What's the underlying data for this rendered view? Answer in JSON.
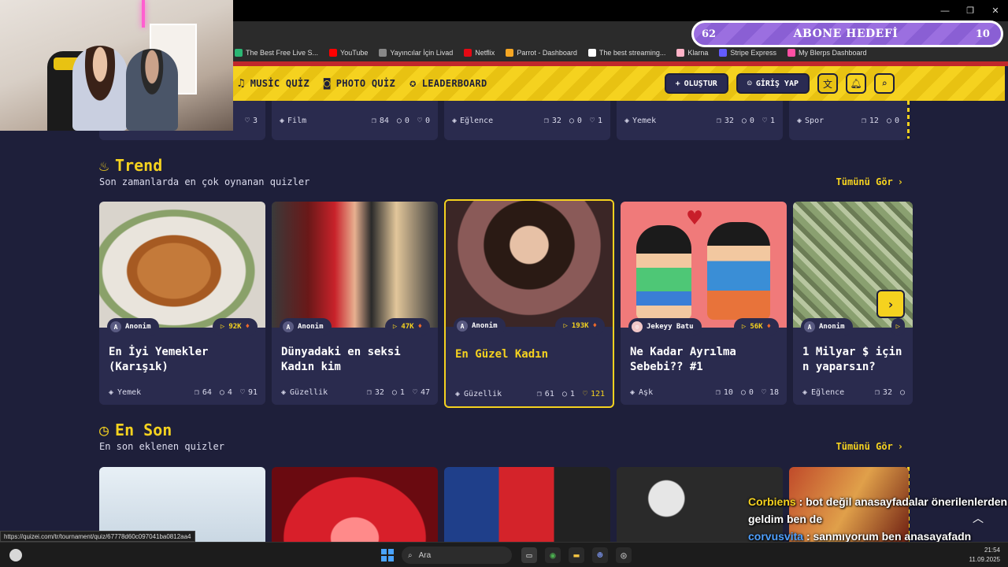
{
  "browser": {
    "bookmarks": [
      {
        "label": "The Best Free Live S...",
        "color": "#2bb673"
      },
      {
        "label": "YouTube",
        "color": "#ff0000"
      },
      {
        "label": "Yayıncılar İçin Livad",
        "color": "#888888"
      },
      {
        "label": "Netflix",
        "color": "#e50914"
      },
      {
        "label": "Parrot - Dashboard",
        "color": "#f5a623"
      },
      {
        "label": "The best streaming...",
        "color": "#ffffff"
      },
      {
        "label": "Klarna",
        "color": "#ffb3c7"
      },
      {
        "label": "Stripe Express",
        "color": "#635bff"
      },
      {
        "label": "My Blerps Dashboard",
        "color": "#ff4fa3"
      }
    ],
    "status_url": "https://quizei.com/tr/tournament/quiz/67778d60c097041ba0812aa4"
  },
  "sub_goal": {
    "current": "62",
    "title": "ABONE HEDEFİ",
    "target": "10"
  },
  "header": {
    "nav": [
      {
        "label": "MUSİC QUİZ",
        "icon": "music-icon"
      },
      {
        "label": "PHOTO QUİZ",
        "icon": "camera-icon"
      },
      {
        "label": "LEADERBOARD",
        "icon": "medal-icon"
      }
    ],
    "create_label": "OLUŞTUR",
    "login_label": "GİRİŞ YAP"
  },
  "top_row": [
    {
      "category": "",
      "likes": "3"
    },
    {
      "category": "Film",
      "questions": "84",
      "comments": "0",
      "likes": "0"
    },
    {
      "category": "Eğlence",
      "questions": "32",
      "comments": "0",
      "likes": "1"
    },
    {
      "category": "Yemek",
      "questions": "32",
      "comments": "0",
      "likes": "1"
    },
    {
      "category": "Spor",
      "questions": "12",
      "comments": "0"
    }
  ],
  "trend": {
    "title": "Trend",
    "subtitle": "Son zamanlarda en çok oynanan quizler",
    "see_all": "Tümünü Gör",
    "cards": [
      {
        "author": "Anonim",
        "plays": "92K",
        "title": "En İyi Yemekler (Karışık)",
        "category": "Yemek",
        "questions": "64",
        "comments": "4",
        "likes": "91"
      },
      {
        "author": "Anonim",
        "plays": "47K",
        "title": "Dünyadaki en seksi Kadın kim",
        "category": "Güzellik",
        "questions": "32",
        "comments": "1",
        "likes": "47"
      },
      {
        "author": "Anonim",
        "plays": "193K",
        "title": "En Güzel Kadın",
        "category": "Güzellik",
        "questions": "61",
        "comments": "1",
        "likes": "121"
      },
      {
        "author": "Jekeyy Batu",
        "plays": "56K",
        "title": "Ne Kadar Ayrılma Sebebi?? #1",
        "category": "Aşk",
        "questions": "10",
        "comments": "0",
        "likes": "18"
      },
      {
        "author": "Anonim",
        "plays": "",
        "title": "1 Milyar $ için n yaparsın?",
        "category": "Eğlence",
        "questions": "32",
        "comments": "",
        "likes": ""
      }
    ]
  },
  "latest": {
    "title": "En Son",
    "subtitle": "En son eklenen quizler",
    "see_all": "Tümünü Gör"
  },
  "chat": [
    {
      "user": "Corbiens",
      "message": ": bot değil anasayfadalar önerilenlerden geldim ben de"
    },
    {
      "user": "corvusvita",
      "message": ": sanmıyorum ben anasayafadn geldim geleneleri çoğuda ordan"
    }
  ],
  "taskbar": {
    "search_placeholder": "Ara",
    "time": "21:54",
    "date": "11.09.2025"
  }
}
